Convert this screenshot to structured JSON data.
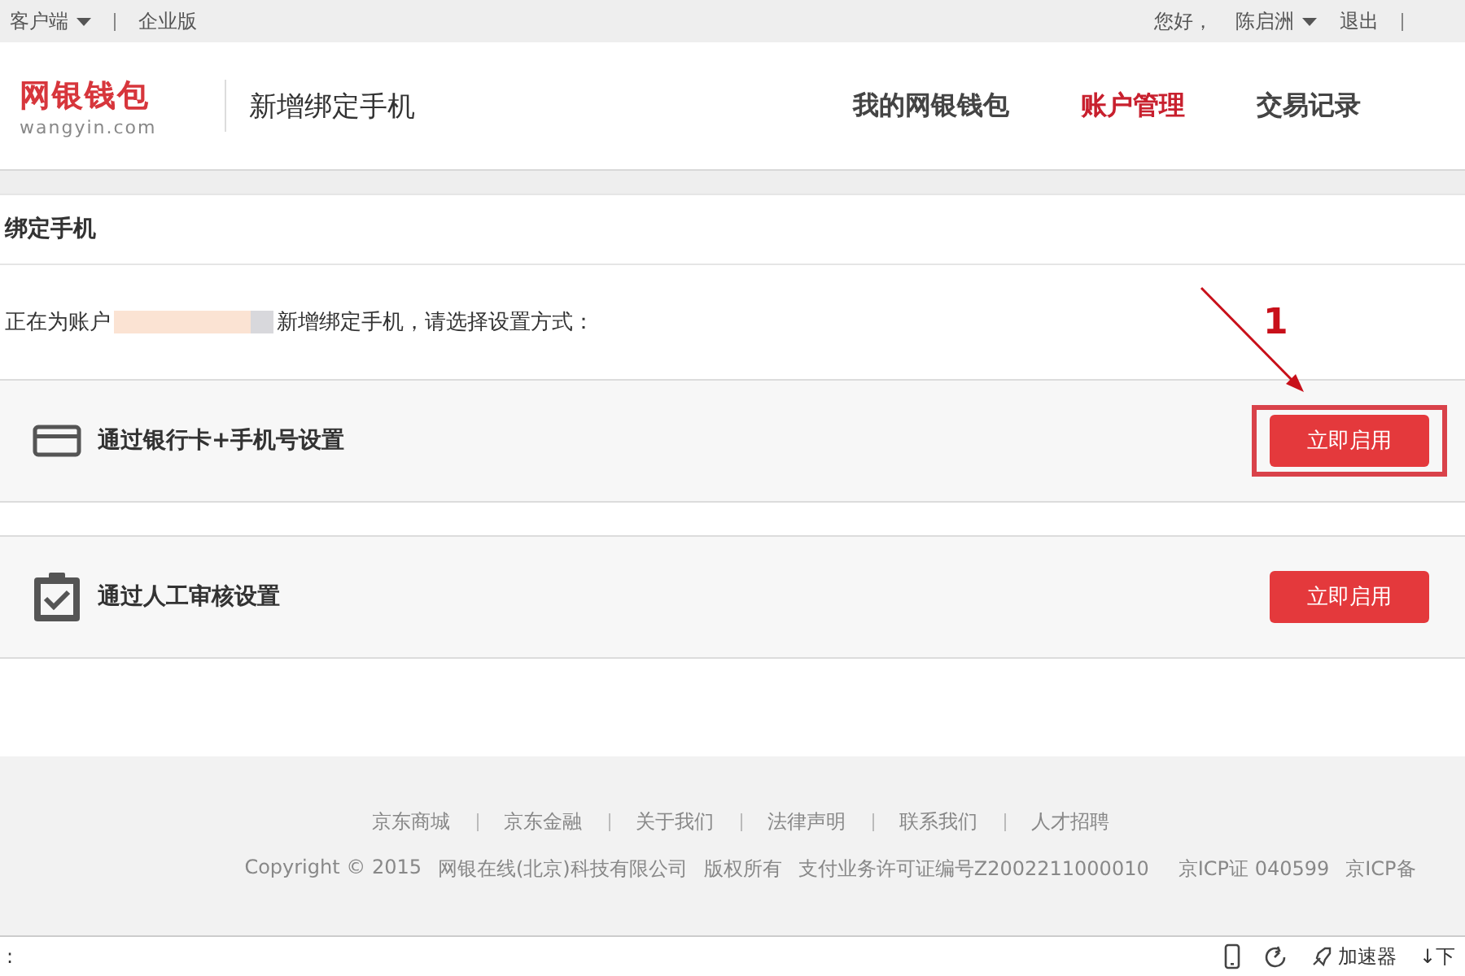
{
  "top_bar": {
    "left": [
      {
        "label": "客户端",
        "dropdown": true
      },
      {
        "label": "企业版",
        "dropdown": false
      }
    ],
    "right": [
      {
        "label": "您好，",
        "dropdown": false
      },
      {
        "label": "陈启洲",
        "dropdown": true
      },
      {
        "label": "退出",
        "dropdown": false
      }
    ]
  },
  "header": {
    "logo_text": "网银钱包",
    "logo_sub": "wangyin.com",
    "page_title": "新增绑定手机",
    "nav": [
      {
        "label": "我的网银钱包",
        "selected": false
      },
      {
        "label": "账户管理",
        "selected": true
      },
      {
        "label": "交易记录",
        "selected": false
      }
    ]
  },
  "section_title": "绑定手机",
  "intro_before": "正在为账户",
  "intro_after": "新增绑定手机，请选择设置方式：",
  "options": [
    {
      "kind": "card",
      "label": "通过银行卡+手机号设置",
      "button": "立即启用",
      "highlighted": true
    },
    {
      "kind": "clipboard",
      "label": "通过人工审核设置",
      "button": "立即启用",
      "highlighted": false
    }
  ],
  "annotation": "1",
  "footer": {
    "links": [
      "京东商城",
      "京东金融",
      "关于我们",
      "法律声明",
      "联系我们",
      "人才招聘"
    ],
    "info": [
      "Copyright © 2015",
      "网银在线(北京)科技有限公司",
      "版权所有",
      "支付业务许可证编号Z2002211000010",
      "京ICP证 040599",
      "京ICP备"
    ]
  },
  "status_bar": {
    "left": ":",
    "accelerator": "加速器",
    "download": "↓下"
  }
}
